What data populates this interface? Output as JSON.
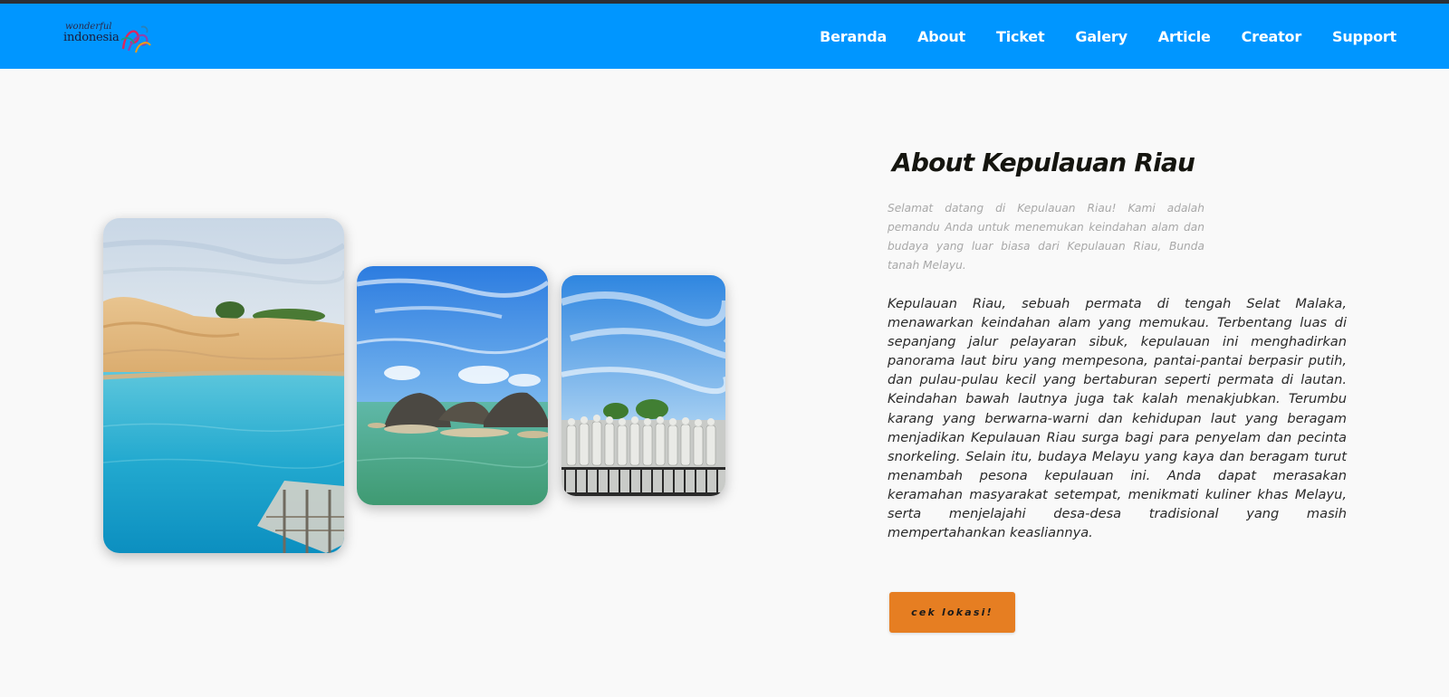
{
  "header": {
    "logo": {
      "small_text": "wonderful",
      "main_text": "indonesia"
    },
    "nav": [
      {
        "label": "Beranda"
      },
      {
        "label": "About"
      },
      {
        "label": "Ticket"
      },
      {
        "label": "Galery"
      },
      {
        "label": "Article"
      },
      {
        "label": "Creator"
      },
      {
        "label": "Support"
      }
    ],
    "colors": {
      "navbar_bg": "#0096ff",
      "top_strip": "#2b2f36"
    }
  },
  "gallery": {
    "images": [
      {
        "name": "turquoise-lake-photo"
      },
      {
        "name": "rock-beach-photo"
      },
      {
        "name": "statues-photo"
      }
    ]
  },
  "about": {
    "title": "About Kepulauan Riau",
    "intro": "Selamat datang di Kepulauan Riau! Kami adalah pemandu Anda untuk menemukan keindahan alam dan budaya yang luar biasa dari Kepulauan Riau, Bunda tanah Melayu.",
    "body": "Kepulauan Riau, sebuah permata di tengah Selat Malaka, menawarkan keindahan alam yang memukau. Terbentang luas di sepanjang jalur pelayaran sibuk, kepulauan ini menghadirkan panorama laut biru yang mempesona, pantai-pantai berpasir putih, dan pulau-pulau kecil yang bertaburan seperti permata di lautan. Keindahan bawah lautnya juga tak kalah menakjubkan. Terumbu karang yang berwarna-warni dan kehidupan laut yang beragam menjadikan Kepulauan Riau surga bagi para penyelam dan pecinta snorkeling. Selain itu, budaya Melayu yang kaya dan beragam turut menambah pesona kepulauan ini. Anda dapat merasakan keramahan masyarakat setempat, menikmati kuliner khas Melayu, serta menjelajahi desa-desa tradisional yang masih mempertahankan keasliannya.",
    "button_label": "cek lokasi!",
    "colors": {
      "button_bg": "#e67e22",
      "title": "#15150f"
    }
  }
}
